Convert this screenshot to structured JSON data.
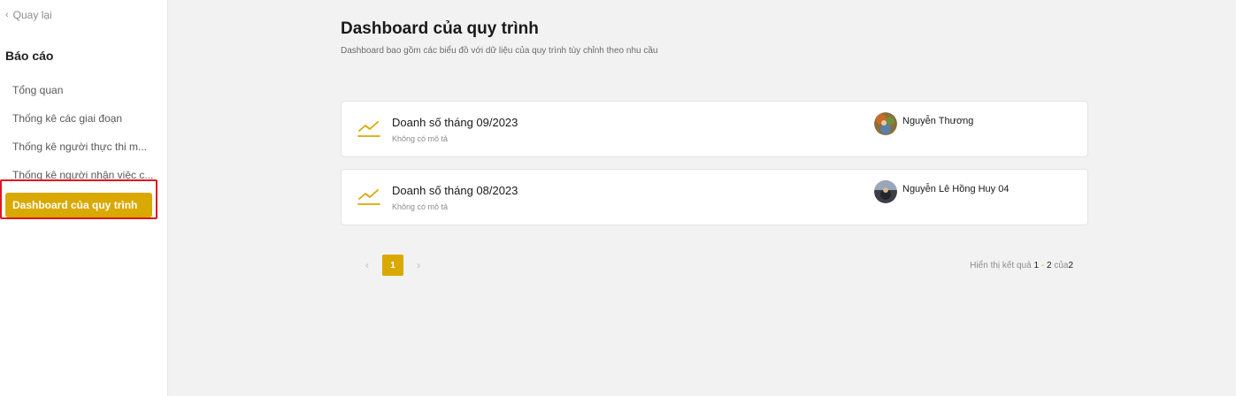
{
  "sidebar": {
    "back_label": "Quay lại",
    "section_title": "Báo cáo",
    "items": [
      {
        "label": "Tổng quan"
      },
      {
        "label": "Thống kê các giai đoạn"
      },
      {
        "label": "Thống kê người thực thi m..."
      },
      {
        "label": "Thống kê người nhận việc c..."
      },
      {
        "label": "Dashboard của quy trình",
        "active": true
      }
    ]
  },
  "main": {
    "title": "Dashboard của quy trình",
    "subtitle": "Dashboard bao gồm các biểu đồ với dữ liệu của quy trình tùy chỉnh theo nhu cầu",
    "cards": [
      {
        "name": "Doanh số tháng 09/2023",
        "description": "Không có mô tả",
        "owner": "Nguyễn Thương",
        "icon": "line-chart-icon"
      },
      {
        "name": "Doanh số tháng 08/2023",
        "description": "Không có mô tả",
        "owner": "Nguyễn Lê Hồng Huy 04",
        "icon": "line-chart-icon"
      }
    ]
  },
  "pagination": {
    "current_page": "1",
    "results_prefix": "Hiển thị kết quả",
    "from": "1",
    "dash": "-",
    "to": "2",
    "of_label": "của",
    "total": "2"
  },
  "colors": {
    "accent": "#d9a900",
    "highlight_border": "#e0141e"
  }
}
